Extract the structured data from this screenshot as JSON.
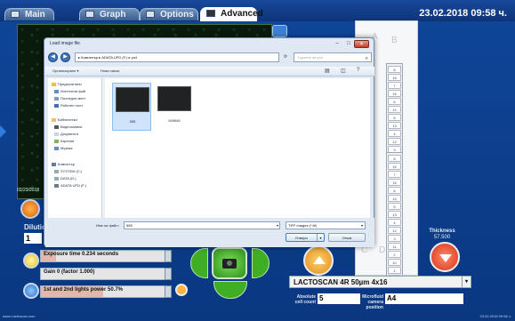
{
  "tabs": [
    {
      "label": "Main",
      "icon": "monitor-icon",
      "active": false
    },
    {
      "label": "Graph",
      "icon": "graph-icon",
      "active": false
    },
    {
      "label": "Options",
      "icon": "options-icon",
      "active": false
    },
    {
      "label": "Advanced",
      "icon": "user-icon",
      "active": true
    }
  ],
  "datetime": "23.02.2018 09:58 ч.",
  "preview": {
    "stamp": "02/23/2018"
  },
  "dilution": {
    "label": "Dilution",
    "value": "1"
  },
  "controls": [
    {
      "label": "Exposure time 0.234 seconds",
      "fill_fraction": 0.12
    },
    {
      "label": "Gain 0 (factor 1.000)",
      "fill_fraction": 0.0
    },
    {
      "label": "1st and 2nd lights power 50.7%",
      "fill_fraction": 0.507
    }
  ],
  "slide": {
    "letters": [
      "A",
      "B",
      "C",
      "D"
    ],
    "top_slots": [
      "8",
      "16",
      "7",
      "15",
      "6",
      "14",
      "5",
      "13",
      "4",
      "12",
      "3",
      "11",
      "2",
      "10",
      "1",
      "9"
    ],
    "bottom_slots": [
      "8",
      "16",
      "7",
      "15",
      "6",
      "14",
      "5",
      "13",
      "4",
      "12",
      "3",
      "11",
      "2",
      "10",
      "1",
      "9"
    ]
  },
  "thickness": {
    "label": "Thickness",
    "value": "57.500"
  },
  "slide_type": {
    "value": "LACTOSCAN 4R 50µm 4x16"
  },
  "info": {
    "absolute_cell_count_label": "Absolute cell count",
    "absolute_cell_count_value": "5",
    "microfluid_camera_position_label": "Microfluid camera position",
    "microfluid_camera_position_value": "A4"
  },
  "footer": {
    "left": "www.Lactoscan.com",
    "right": "23.02.2018 09:58 ч."
  },
  "dialog": {
    "title": "Load image file",
    "close_label": "✕",
    "address": "▸ Компютър ▸ ADATA UFD (F:) ▸ yo4",
    "search_placeholder": "Търсене на yo4",
    "toolbar": {
      "organize": "Организиране ▾",
      "new_folder": "Нова папка"
    },
    "nav_items": [
      {
        "label": "Предпочитани",
        "color": "#f0c23a"
      },
      {
        "label": "Изтеглени фай",
        "color": "#5a8ed0"
      },
      {
        "label": "Последни мест",
        "color": "#7b9bc4"
      },
      {
        "label": "Работен плот",
        "color": "#3c6fb5"
      },
      {
        "label": "Библиотеки",
        "color": "#e8c070"
      },
      {
        "label": "Видеозаписи",
        "color": "#555"
      },
      {
        "label": "Документи",
        "color": "#c9d4e2"
      },
      {
        "label": "Картини",
        "color": "#7cb35b"
      },
      {
        "label": "Музика",
        "color": "#5b8fd0"
      },
      {
        "label": "Компютър",
        "color": "#5b7fa8"
      },
      {
        "label": "SYSTEM (C:)",
        "color": "#9aa8b8"
      },
      {
        "label": "DATA (D:)",
        "color": "#9aa8b8"
      },
      {
        "label": "ADATA UFD (F:)",
        "color": "#6d7c8c"
      }
    ],
    "files": [
      {
        "name": "555",
        "selected": true
      },
      {
        "name": "645646",
        "selected": false
      }
    ],
    "filename_label": "Име на файл:",
    "filename_value": "555",
    "filetype": "TIFF images (*.tif)",
    "open_label": "Отвори",
    "cancel_label": "Отказ"
  }
}
